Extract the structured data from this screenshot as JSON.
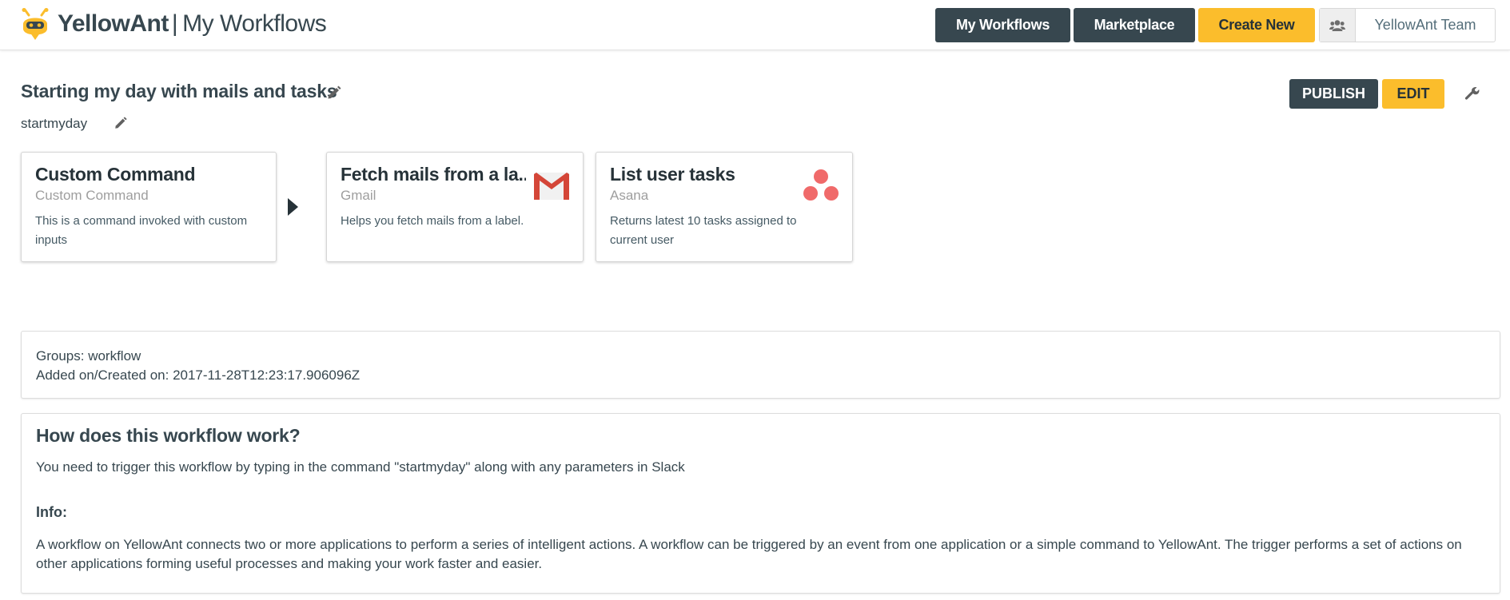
{
  "header": {
    "brand": "YellowAnt",
    "separator": "|",
    "page_title": "My Workflows",
    "nav": {
      "my_workflows": "My Workflows",
      "marketplace": "Marketplace",
      "create_new": "Create New"
    },
    "team": {
      "icon": "users-icon",
      "name": "YellowAnt Team"
    }
  },
  "workflow": {
    "title": "Starting my day with mails and tasks",
    "slug": "startmyday",
    "publish_label": "PUBLISH",
    "edit_label": "EDIT"
  },
  "cards": [
    {
      "title": "Custom Command",
      "app": "Custom Command",
      "description": "This is a command invoked with custom inputs",
      "icon": "none"
    },
    {
      "title": "Fetch mails from a la...",
      "app": "Gmail",
      "description": "Helps you fetch mails from a label.",
      "icon": "gmail-icon"
    },
    {
      "title": "List user tasks",
      "app": "Asana",
      "description": "Returns latest 10 tasks assigned to current user",
      "icon": "asana-icon"
    }
  ],
  "meta": {
    "groups": "Groups: workflow",
    "created": "Added on/Created on: 2017-11-28T12:23:17.906096Z"
  },
  "how": {
    "title": "How does this workflow work?",
    "text": "You need to trigger this workflow by typing in the command \"startmyday\" along with any parameters in Slack",
    "info_heading": "Info:",
    "info_text": "A workflow on YellowAnt connects two or more applications to perform a series of intelligent actions. A workflow can be triggered by an event from one application or a simple command to YellowAnt. The trigger performs a set of actions on other applications forming useful processes and making your work faster and easier."
  },
  "colors": {
    "dark": "#37474f",
    "yellow": "#fbbd2c",
    "gmail_red": "#d44638",
    "asana_pink": "#f06a6a"
  }
}
